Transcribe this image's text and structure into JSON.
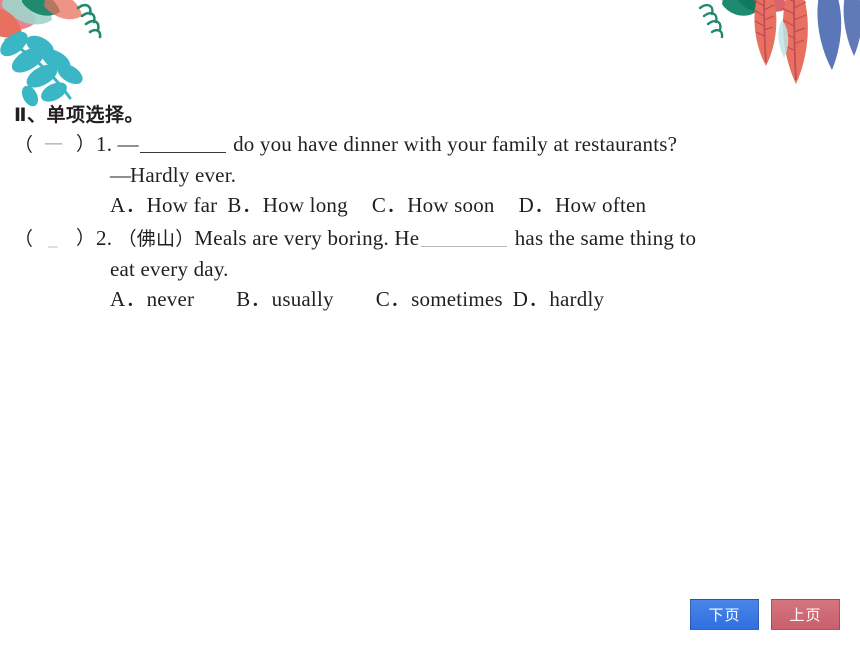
{
  "page": {
    "background_color": "#ffffff",
    "text_color": "#231f20"
  },
  "section": {
    "title": "Ⅱ、单项选择。"
  },
  "questions": [
    {
      "number": "1.",
      "answer_mark": "一",
      "paren_left": "（",
      "paren_right": "）",
      "lines": [
        {
          "prefix": "—",
          "blank": true,
          "text": "do you have dinner with your family at restaurants?"
        },
        {
          "prefix": "—",
          "blank": false,
          "text": "Hardly ever."
        }
      ],
      "options": [
        {
          "letter": "A．",
          "text": "How far"
        },
        {
          "letter": "B．",
          "text": "How long"
        },
        {
          "letter": "C．",
          "text": "How soon"
        },
        {
          "letter": "D．",
          "text": "How often"
        }
      ]
    },
    {
      "number": "2.",
      "answer_mark": "_",
      "paren_left": "（",
      "paren_right": "）",
      "lines": [
        {
          "source_tag": "（佛山）",
          "text_before_blank": "Meals are very boring. He",
          "blank": true,
          "text_after_blank": "has the same thing to"
        },
        {
          "text": "eat every day."
        }
      ],
      "options": [
        {
          "letter": "A．",
          "text": "never"
        },
        {
          "letter": "B．",
          "text": "usually"
        },
        {
          "letter": "C．",
          "text": "sometimes"
        },
        {
          "letter": "D．",
          "text": "hardly"
        }
      ]
    }
  ],
  "nav": {
    "next_label": "下页",
    "prev_label": "上页",
    "next_color": "#3a7ae4",
    "prev_color": "#cb6a74"
  },
  "decorations": {
    "top_left": "leaf-branch-decoration",
    "top_right": "feather-leaf-decoration",
    "palette": {
      "teal": "#3ab6c4",
      "coral": "#e8705f",
      "pink": "#e8848f",
      "green": "#1f8a6d",
      "blue": "#5b77b8",
      "mint": "#9ed4cc"
    }
  }
}
